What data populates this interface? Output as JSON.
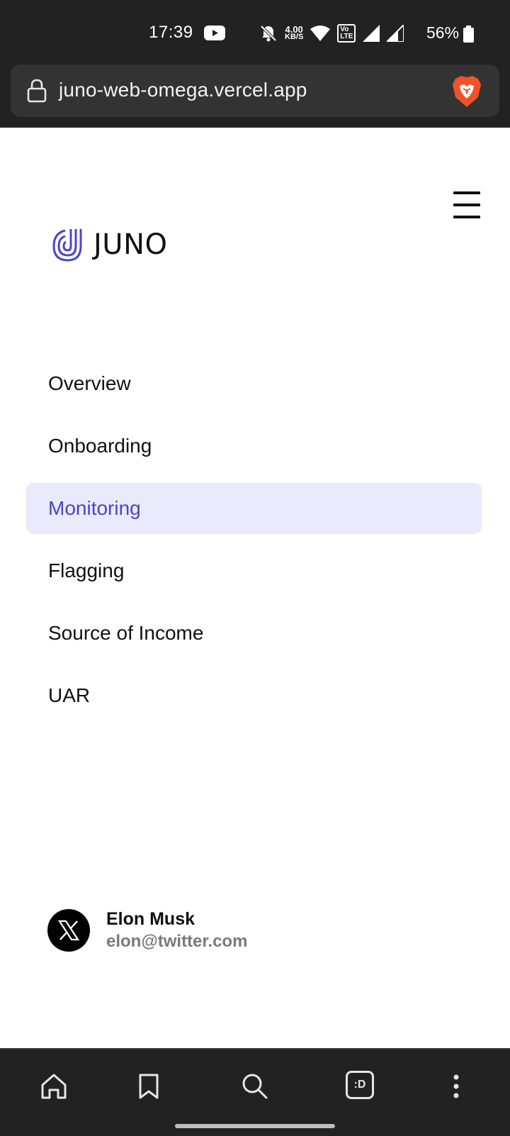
{
  "status_bar": {
    "time": "17:39",
    "net_speed_value": "4.00",
    "net_speed_unit": "KB/S",
    "volte_top": "Vo",
    "volte_bottom": "LTE",
    "battery_percent": "56%",
    "icons": [
      "youtube-icon",
      "bell-off-icon",
      "wifi-icon",
      "volte-icon",
      "signal-icon",
      "battery-icon"
    ]
  },
  "browser": {
    "url": "juno-web-omega.vercel.app",
    "icons": [
      "lock-icon",
      "brave-icon"
    ]
  },
  "header": {
    "brand": "JUNO",
    "brand_color": "#4b45c8",
    "menu_icon": "hamburger-menu-icon"
  },
  "nav": {
    "items": [
      {
        "label": "Overview",
        "active": false
      },
      {
        "label": "Onboarding",
        "active": false
      },
      {
        "label": "Monitoring",
        "active": true
      },
      {
        "label": "Flagging",
        "active": false
      },
      {
        "label": "Source of Income",
        "active": false
      },
      {
        "label": "UAR",
        "active": false
      }
    ],
    "active_bg": "#e9eafb",
    "active_color": "#4b45c8"
  },
  "user": {
    "name": "Elon Musk",
    "email": "elon@twitter.com",
    "avatar_icon": "x-logo-icon"
  },
  "bottom_bar": {
    "icons": [
      "home-icon",
      "bookmark-icon",
      "search-icon",
      "tabs-icon",
      "more-icon"
    ],
    "tabs_label": ":D"
  }
}
